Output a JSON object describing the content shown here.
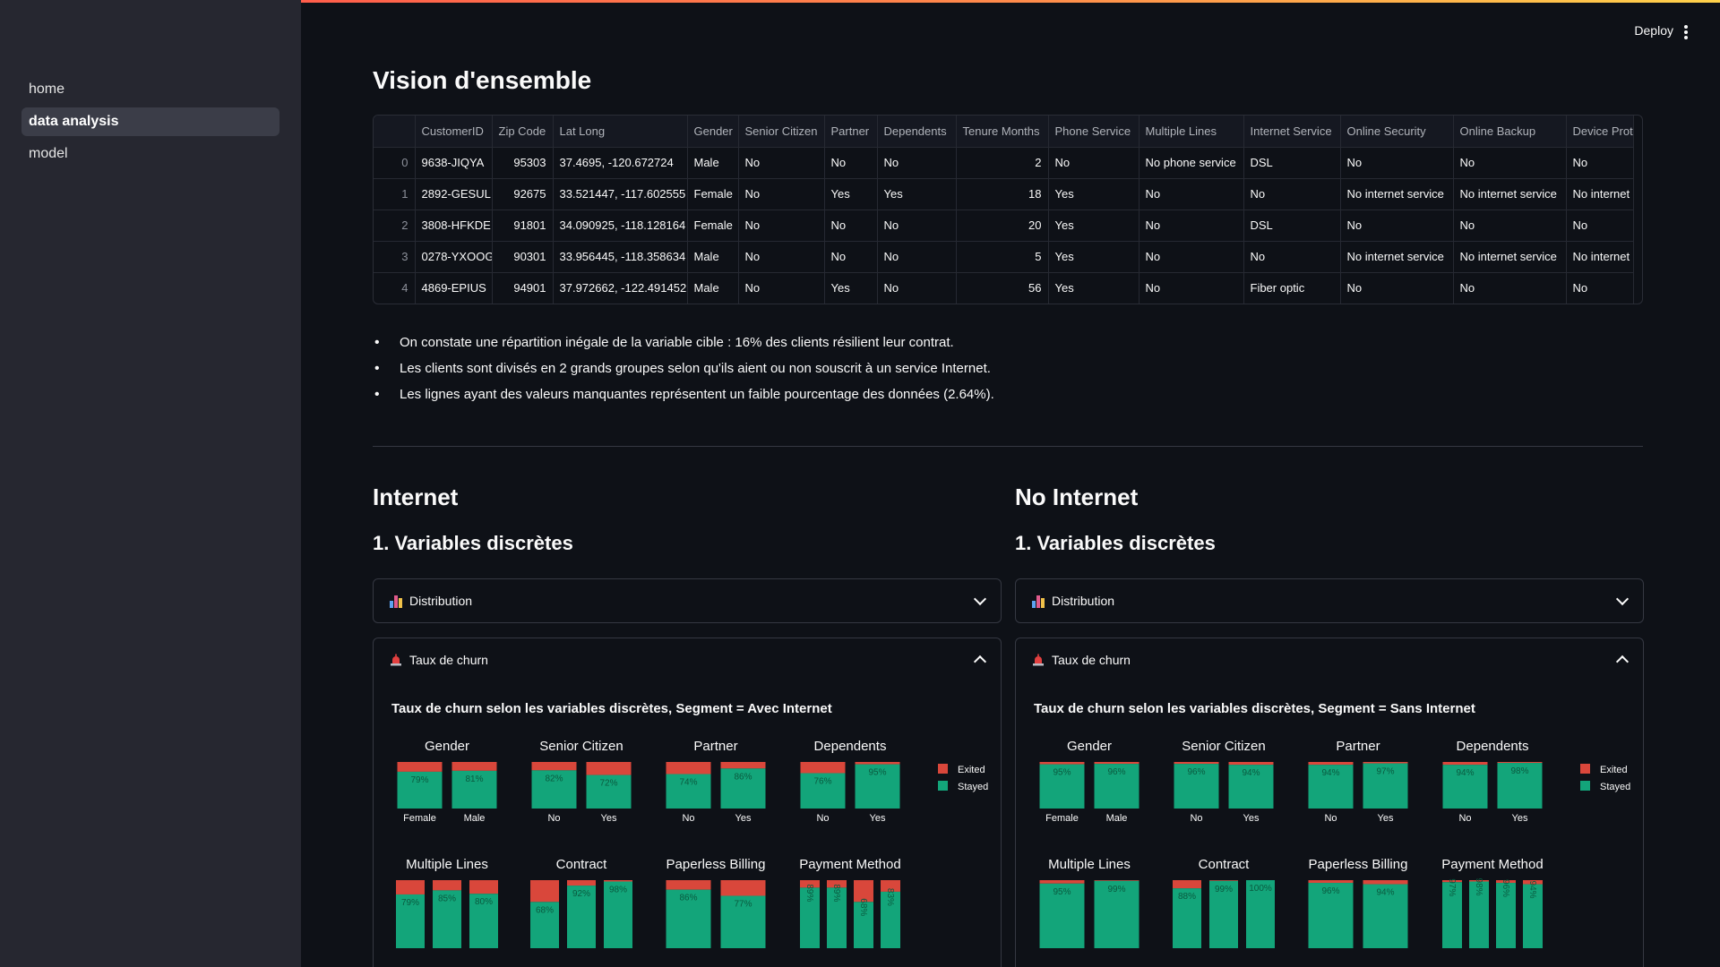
{
  "sidebar": {
    "items": [
      {
        "label": "home"
      },
      {
        "label": "data analysis"
      },
      {
        "label": "model"
      }
    ]
  },
  "header": {
    "deploy_label": "Deploy"
  },
  "page": {
    "title": "Vision d'ensemble"
  },
  "table": {
    "columns": [
      "",
      "CustomerID",
      "Zip Code",
      "Lat Long",
      "Gender",
      "Senior Citizen",
      "Partner",
      "Dependents",
      "Tenure Months",
      "Phone Service",
      "Multiple Lines",
      "Internet Service",
      "Online Security",
      "Online Backup",
      "Device Prot"
    ],
    "rows": [
      [
        "0",
        "9638-JIQYA",
        "95303",
        "37.4695, -120.672724",
        "Male",
        "No",
        "No",
        "No",
        "2",
        "No",
        "No phone service",
        "DSL",
        "No",
        "No",
        "No"
      ],
      [
        "1",
        "2892-GESUL",
        "92675",
        "33.521447, -117.602555",
        "Female",
        "No",
        "Yes",
        "Yes",
        "18",
        "Yes",
        "No",
        "No",
        "No internet service",
        "No internet service",
        "No internet"
      ],
      [
        "2",
        "3808-HFKDE",
        "91801",
        "34.090925, -118.128164",
        "Female",
        "No",
        "No",
        "No",
        "20",
        "Yes",
        "No",
        "DSL",
        "No",
        "No",
        "No"
      ],
      [
        "3",
        "0278-YXOOG",
        "90301",
        "33.956445, -118.358634",
        "Male",
        "No",
        "No",
        "No",
        "5",
        "Yes",
        "No",
        "No",
        "No internet service",
        "No internet service",
        "No internet"
      ],
      [
        "4",
        "4869-EPIUS",
        "94901",
        "37.972662, -122.491452",
        "Male",
        "No",
        "Yes",
        "No",
        "56",
        "Yes",
        "No",
        "Fiber optic",
        "No",
        "No",
        "No"
      ]
    ]
  },
  "bullets": [
    "On constate une répartition inégale de la variable cible : 16% des clients résilient leur contrat.",
    "Les clients sont divisés en 2 grands groupes selon qu'ils aient ou non souscrit à un service Internet.",
    "Les lignes ayant des valeurs manquantes représentent un faible pourcentage des données (2.64%)."
  ],
  "sections": [
    {
      "heading": "Internet",
      "subheading": "1. Variables discrètes",
      "distribution_label": "Distribution",
      "churn_label": "Taux de churn",
      "chart_title": "Taux de churn selon les variables discrètes, Segment = Avec Internet"
    },
    {
      "heading": "No Internet",
      "subheading": "1. Variables discrètes",
      "distribution_label": "Distribution",
      "churn_label": "Taux de churn",
      "chart_title": "Taux de churn selon les variables discrètes, Segment = Sans Internet"
    }
  ],
  "colors": {
    "exited": "#d9473b",
    "stayed": "#13a57a",
    "accent": "#ff4b4b"
  },
  "chart_data": [
    {
      "type": "bar",
      "title": "Taux de churn selon les variables discrètes, Segment = Avec Internet",
      "legend": [
        "Exited",
        "Stayed"
      ],
      "legend_placement": "right",
      "panels": [
        {
          "title": "Gender",
          "categories": [
            "Female",
            "Male"
          ],
          "stayed": [
            79,
            81
          ]
        },
        {
          "title": "Senior Citizen",
          "categories": [
            "No",
            "Yes"
          ],
          "stayed": [
            82,
            72
          ]
        },
        {
          "title": "Partner",
          "categories": [
            "No",
            "Yes"
          ],
          "stayed": [
            74,
            86
          ]
        },
        {
          "title": "Dependents",
          "categories": [
            "No",
            "Yes"
          ],
          "stayed": [
            76,
            95
          ]
        },
        {
          "title": "Multiple Lines",
          "categories": [
            "",
            "",
            ""
          ],
          "stayed": [
            79,
            85,
            80
          ]
        },
        {
          "title": "Contract",
          "categories": [
            "",
            "",
            ""
          ],
          "stayed": [
            68,
            92,
            98
          ]
        },
        {
          "title": "Paperless Billing",
          "categories": [
            "",
            ""
          ],
          "stayed": [
            86,
            77
          ]
        },
        {
          "title": "Payment Method",
          "categories": [
            "",
            "",
            "",
            ""
          ],
          "stayed": [
            89,
            89,
            68,
            83
          ]
        }
      ]
    },
    {
      "type": "bar",
      "title": "Taux de churn selon les variables discrètes, Segment = Sans Internet",
      "legend": [
        "Exited",
        "Stayed"
      ],
      "legend_placement": "right",
      "panels": [
        {
          "title": "Gender",
          "categories": [
            "Female",
            "Male"
          ],
          "stayed": [
            95,
            96
          ]
        },
        {
          "title": "Senior Citizen",
          "categories": [
            "No",
            "Yes"
          ],
          "stayed": [
            96,
            94
          ]
        },
        {
          "title": "Partner",
          "categories": [
            "No",
            "Yes"
          ],
          "stayed": [
            94,
            97
          ]
        },
        {
          "title": "Dependents",
          "categories": [
            "No",
            "Yes"
          ],
          "stayed": [
            94,
            98
          ]
        },
        {
          "title": "Multiple Lines",
          "categories": [
            "",
            ""
          ],
          "stayed": [
            95,
            99
          ]
        },
        {
          "title": "Contract",
          "categories": [
            "",
            "",
            ""
          ],
          "stayed": [
            88,
            99,
            100
          ]
        },
        {
          "title": "Paperless Billing",
          "categories": [
            "",
            ""
          ],
          "stayed": [
            96,
            94
          ]
        },
        {
          "title": "Payment Method",
          "categories": [
            "",
            "",
            "",
            ""
          ],
          "stayed": [
            97,
            98,
            96,
            94
          ]
        }
      ]
    }
  ]
}
